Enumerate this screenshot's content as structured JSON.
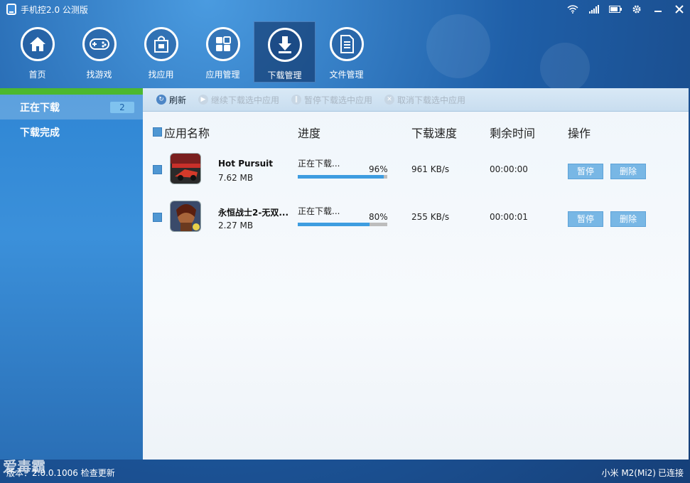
{
  "titlebar": {
    "title": "手机控2.0 公测版",
    "icons": [
      "wifi-icon",
      "signal-icon",
      "battery-icon",
      "gear-icon",
      "minimize-icon",
      "close-icon"
    ]
  },
  "nav": {
    "items": [
      {
        "label": "首页",
        "icon": "home-icon"
      },
      {
        "label": "找游戏",
        "icon": "gamepad-icon"
      },
      {
        "label": "找应用",
        "icon": "shopping-bag-icon"
      },
      {
        "label": "应用管理",
        "icon": "grid-icon"
      },
      {
        "label": "下载管理",
        "icon": "download-icon",
        "active": true
      },
      {
        "label": "文件管理",
        "icon": "document-icon"
      }
    ]
  },
  "sidebar": {
    "items": [
      {
        "label": "正在下载",
        "badge": "2",
        "active": true
      },
      {
        "label": "下载完成"
      }
    ]
  },
  "toolbar": {
    "refresh": "刷新",
    "resume": "继续下载选中应用",
    "pause": "暂停下载选中应用",
    "cancel": "取消下载选中应用"
  },
  "table": {
    "headers": {
      "name": "应用名称",
      "progress": "进度",
      "speed": "下载速度",
      "remaining": "剩余时间",
      "actions": "操作"
    },
    "rows": [
      {
        "name": "Hot Pursuit",
        "size": "7.62 MB",
        "status": "正在下载...",
        "percent": "96%",
        "progress": 0.96,
        "speed": "961 KB/s",
        "remaining": "00:00:00",
        "pause": "暂停",
        "delete": "删除"
      },
      {
        "name": "永恒战士2-无双...",
        "size": "2.27 MB",
        "status": "正在下载...",
        "percent": "80%",
        "progress": 0.8,
        "speed": "255 KB/s",
        "remaining": "00:00:01",
        "pause": "暂停",
        "delete": "删除"
      }
    ]
  },
  "statusbar": {
    "version": "版本：2.0.0.1006 检查更新",
    "device": "小米 M2(Mi2)",
    "connection": "已连接"
  },
  "watermark": "爱毒霸",
  "colors": {
    "accent": "#3e9de0",
    "sidebar_strip": "#4cb82f",
    "button": "#78b7e5"
  }
}
